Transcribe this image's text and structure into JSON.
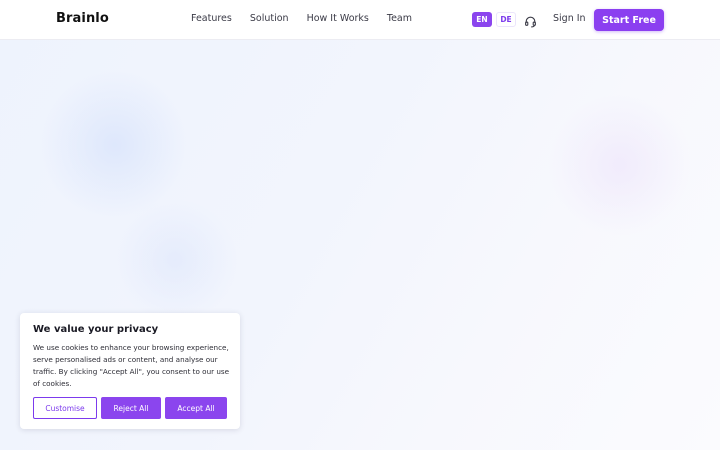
{
  "navbar": {
    "logo": "Brainlo",
    "links": [
      "Features",
      "Solution",
      "How It Works",
      "Team"
    ],
    "languages": {
      "en": "EN",
      "de": "DE",
      "active": "EN"
    },
    "support_icon": "headset-icon",
    "sign_in": "Sign In",
    "cta": "Start Free"
  },
  "cookie_banner": {
    "title": "We value your privacy",
    "text": "We use cookies to enhance your browsing experience, serve personalised ads or content, and analyse our traffic. By clicking \"Accept All\", you consent to our use of cookies.",
    "buttons": {
      "customise": "Customise",
      "reject": "Reject All",
      "accept": "Accept All"
    }
  },
  "colors": {
    "accent": "#8b45ee",
    "text": "#1a1a24"
  }
}
